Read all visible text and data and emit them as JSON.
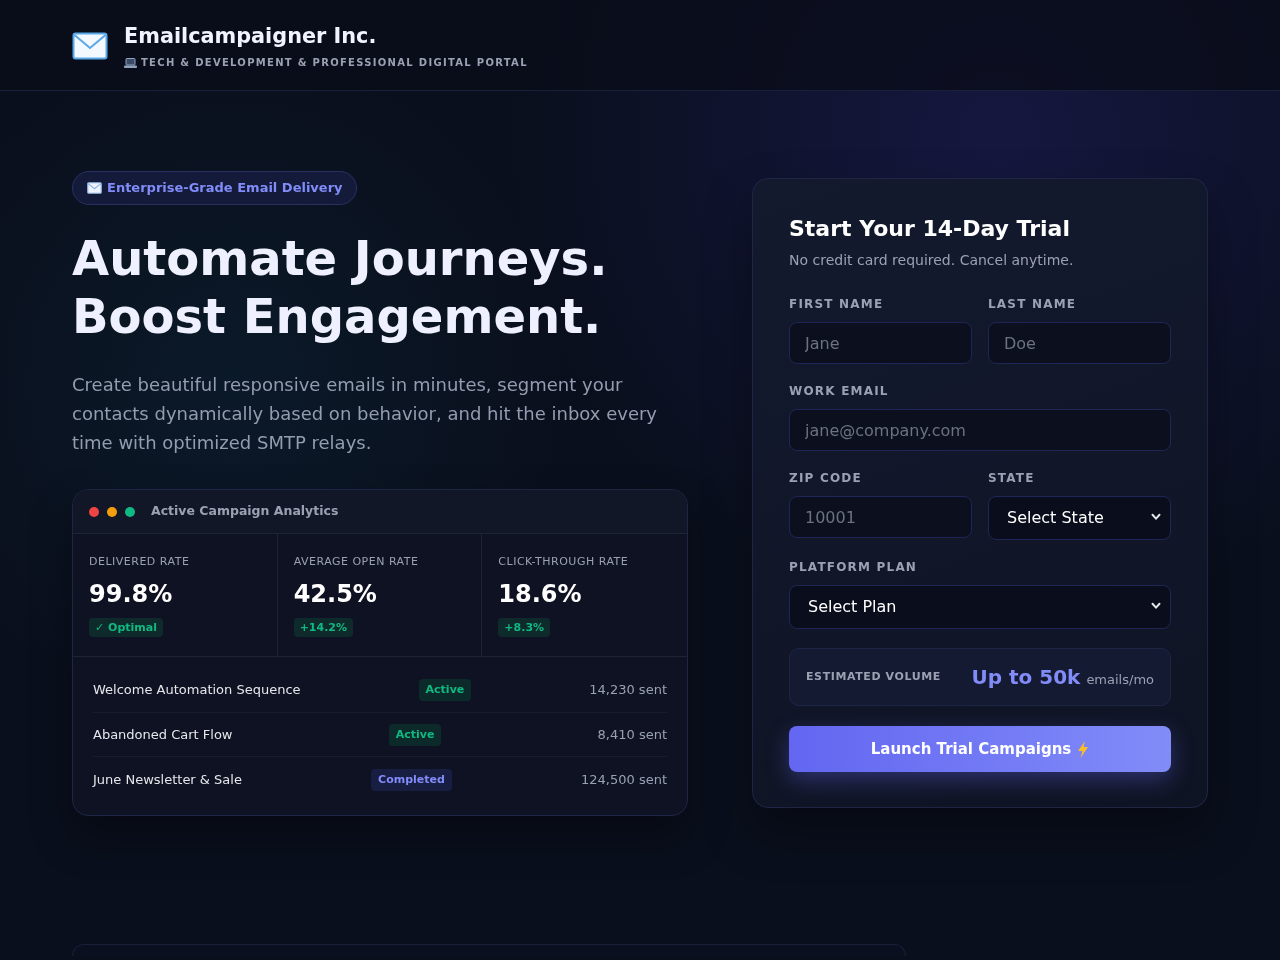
{
  "header": {
    "brand": "Emailcampaigner Inc.",
    "tagline": "TECH & DEVELOPMENT & PROFESSIONAL DIGITAL PORTAL"
  },
  "hero": {
    "badge": "Enterprise-Grade Email Delivery",
    "headline": [
      "Automate Journeys.",
      "Boost Engagement."
    ],
    "description": "Create beautiful responsive emails in minutes, segment your contacts dynamically based on behavior, and hit the inbox every time with optimized SMTP relays."
  },
  "analytics": {
    "window_dots": [
      {
        "color": "#ef4444"
      },
      {
        "color": "#f59e0b"
      },
      {
        "color": "#10b981"
      }
    ],
    "title": "Active Campaign Analytics",
    "metrics": [
      {
        "label": "DELIVERED RATE",
        "value": "99.8%",
        "change": "✓ Optimal"
      },
      {
        "label": "AVERAGE OPEN RATE",
        "value": "42.5%",
        "change": "+14.2%"
      },
      {
        "label": "CLICK-THROUGH RATE",
        "value": "18.6%",
        "change": "+8.3%"
      }
    ],
    "campaigns": [
      {
        "name": "Welcome Automation Sequence",
        "status": "Active",
        "kind": "active",
        "sent": "14,230 sent"
      },
      {
        "name": "Abandoned Cart Flow",
        "status": "Active",
        "kind": "active",
        "sent": "8,410 sent"
      },
      {
        "name": "June Newsletter & Sale",
        "status": "Completed",
        "kind": "completed",
        "sent": "124,500 sent"
      }
    ]
  },
  "trial_form": {
    "title": "Start Your 14-Day Trial",
    "subtitle": "No credit card required. Cancel anytime.",
    "rows": [
      [
        {
          "kind": "input",
          "label": "FIRST NAME",
          "placeholder": "Jane"
        },
        {
          "kind": "input",
          "label": "LAST NAME",
          "placeholder": "Doe"
        }
      ],
      [
        {
          "kind": "input",
          "label": "WORK EMAIL",
          "placeholder": "jane@company.com"
        }
      ],
      [
        {
          "kind": "input",
          "label": "ZIP CODE",
          "placeholder": "10001"
        },
        {
          "kind": "select",
          "label": "STATE",
          "value": "Select State"
        }
      ],
      [
        {
          "kind": "select",
          "label": "PLATFORM PLAN",
          "value": "Select Plan"
        }
      ]
    ],
    "estimate": {
      "label": "ESTIMATED VOLUME",
      "value": "Up to 50k",
      "unit": "emails/mo"
    },
    "submit": "Launch Trial Campaigns"
  }
}
